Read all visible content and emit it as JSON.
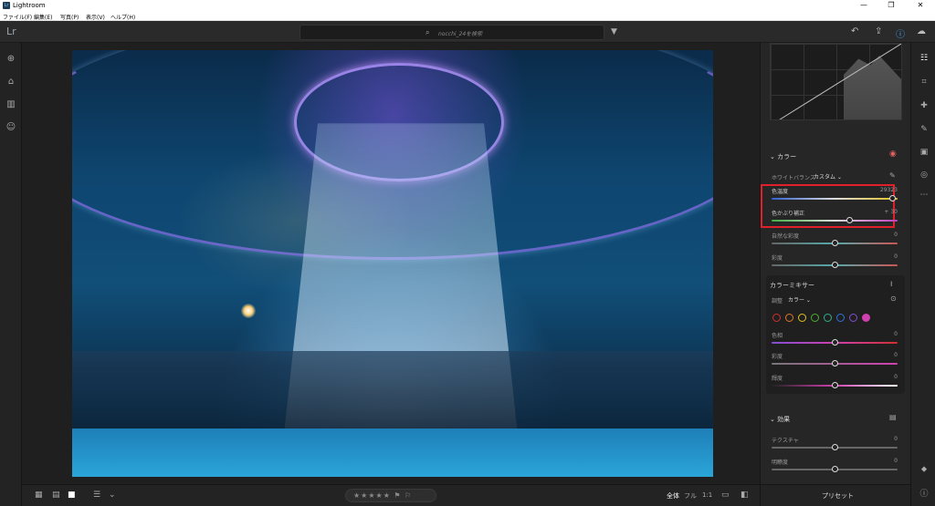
{
  "window": {
    "title": "Lightroom",
    "minimize": "—",
    "maximize": "❐",
    "close": "✕"
  },
  "menu": [
    "ファイル(F)",
    "編集(E)",
    "写真(P)",
    "表示(V)",
    "ヘルプ(H)"
  ],
  "topbar": {
    "logo": "Lr",
    "search_placeholder": "nocchi_24を検索"
  },
  "bottombar": {
    "stars": "★★★★★",
    "zoom_fit": "全体",
    "zoom_full": "フル",
    "zoom_ratio": "1:1"
  },
  "panel": {
    "color_section": "カラー",
    "wb_label": "ホワイトバランス",
    "wb_value": "カスタム",
    "temp_label": "色温度",
    "temp_value": "29323",
    "temp_level": 0.93,
    "tint_label": "色かぶり補正",
    "tint_value": "+ 30",
    "tint_level": 0.62,
    "vibrance_label": "自然な彩度",
    "vibrance_value": "0",
    "saturation_label": "彩度",
    "saturation_value": "0",
    "mixer_section": "カラーミキサー",
    "adjust_label": "調整",
    "adjust_value": "カラー",
    "hue_label": "色相",
    "hue_value": "0",
    "sat2_label": "彩度",
    "sat2_value": "0",
    "lum_label": "輝度",
    "lum_value": "0",
    "effects_section": "効果",
    "texture_label": "テクスチャ",
    "texture_value": "0",
    "clarity_label": "明瞭度",
    "clarity_value": "0",
    "preset_label": "プリセット"
  },
  "mixer_colors": [
    "#d03030",
    "#e07820",
    "#e0c020",
    "#50b030",
    "#30b090",
    "#3070e0",
    "#8050d0",
    "#d040b0"
  ]
}
